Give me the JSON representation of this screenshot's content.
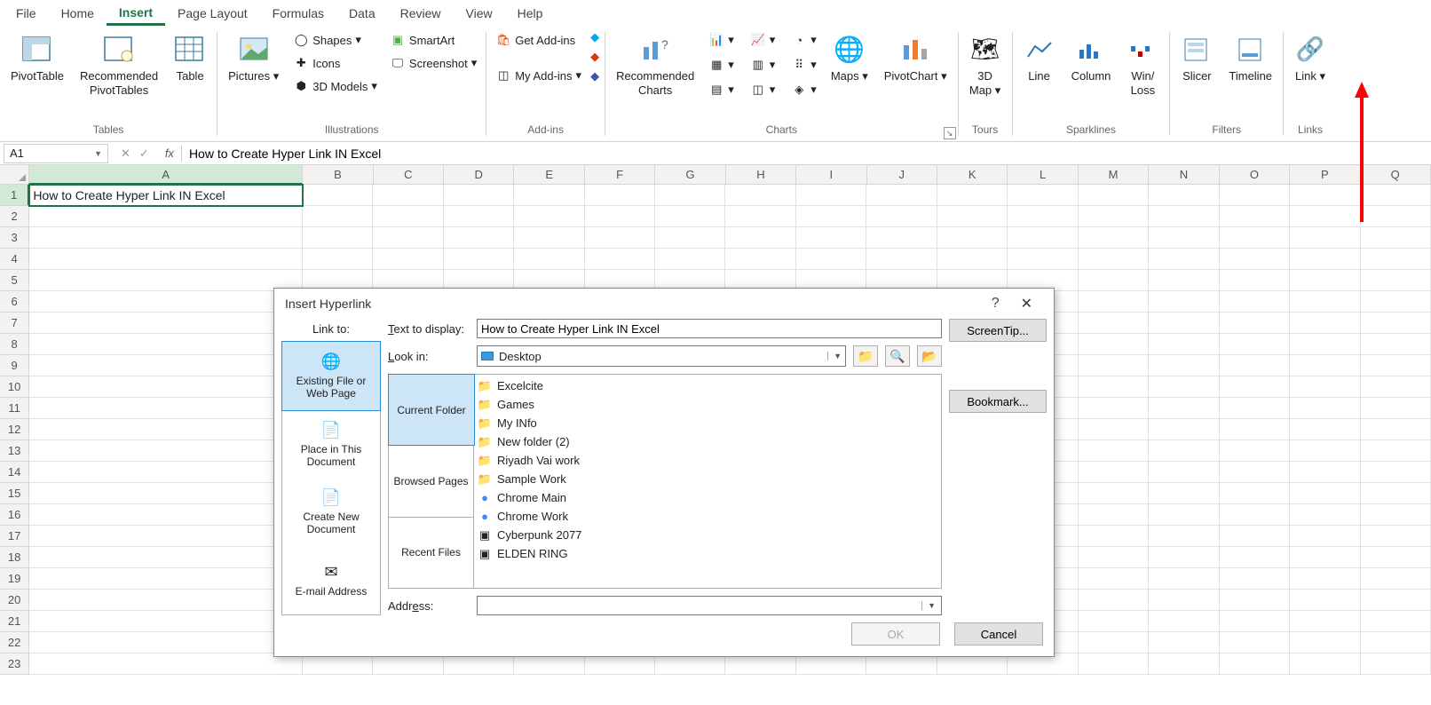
{
  "menu": {
    "tabs": [
      "File",
      "Home",
      "Insert",
      "Page Layout",
      "Formulas",
      "Data",
      "Review",
      "View",
      "Help"
    ],
    "active": "Insert"
  },
  "ribbon": {
    "tables": {
      "label": "Tables",
      "pivot": "PivotTable",
      "rec": "Recommended\nPivotTables",
      "table": "Table"
    },
    "illus": {
      "label": "Illustrations",
      "pictures": "Pictures",
      "shapes": "Shapes",
      "icons": "Icons",
      "models": "3D Models",
      "smartart": "SmartArt",
      "screenshot": "Screenshot"
    },
    "addins": {
      "label": "Add-ins",
      "get": "Get Add-ins",
      "my": "My Add-ins"
    },
    "charts": {
      "label": "Charts",
      "rec": "Recommended\nCharts",
      "maps": "Maps",
      "pivotchart": "PivotChart"
    },
    "tours": {
      "label": "Tours",
      "map": "3D\nMap"
    },
    "spark": {
      "label": "Sparklines",
      "line": "Line",
      "col": "Column",
      "wl": "Win/\nLoss"
    },
    "filters": {
      "label": "Filters",
      "slicer": "Slicer",
      "timeline": "Timeline"
    },
    "links": {
      "label": "Links",
      "link": "Link"
    }
  },
  "fbar": {
    "name": "A1",
    "fx": "fx",
    "formula": "How to Create Hyper Link IN Excel"
  },
  "grid": {
    "cols": [
      "A",
      "B",
      "C",
      "D",
      "E",
      "F",
      "G",
      "H",
      "I",
      "J",
      "K",
      "L",
      "M",
      "N",
      "O",
      "P",
      "Q"
    ],
    "colw_A": 314,
    "colw_rest": 81,
    "rows": 23,
    "a1": "How to Create Hyper Link IN Excel"
  },
  "dialog": {
    "title": "Insert Hyperlink",
    "linkto_label": "Link to:",
    "linkto_items": [
      {
        "label": "Existing File or Web Page",
        "icon": "🌐"
      },
      {
        "label": "Place in This Document",
        "icon": "📄"
      },
      {
        "label": "Create New Document",
        "icon": "📄"
      },
      {
        "label": "E-mail Address",
        "icon": "✉"
      }
    ],
    "text_to_display_label": "Text to display:",
    "text_to_display": "How to Create Hyper Link IN Excel",
    "screentip": "ScreenTip...",
    "lookin_label": "Look in:",
    "lookin_value": "Desktop",
    "browse_tabs": [
      "Current Folder",
      "Browsed Pages",
      "Recent Files"
    ],
    "files": [
      {
        "name": "Excelcite",
        "type": "folder"
      },
      {
        "name": "Games",
        "type": "folder"
      },
      {
        "name": "My INfo",
        "type": "folder"
      },
      {
        "name": "New folder (2)",
        "type": "folder"
      },
      {
        "name": "Riyadh Vai work",
        "type": "folder"
      },
      {
        "name": "Sample Work",
        "type": "folder"
      },
      {
        "name": "Chrome Main",
        "type": "chrome"
      },
      {
        "name": "Chrome Work",
        "type": "chrome"
      },
      {
        "name": "Cyberpunk 2077",
        "type": "app"
      },
      {
        "name": "ELDEN RING",
        "type": "app"
      }
    ],
    "bookmark": "Bookmark...",
    "address_label": "Address:",
    "address_value": "",
    "ok": "OK",
    "cancel": "Cancel"
  }
}
